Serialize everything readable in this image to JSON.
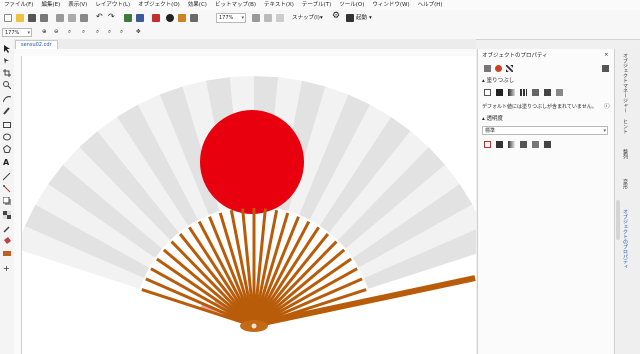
{
  "menu": [
    "ファイル(F)",
    "編集(E)",
    "表示(V)",
    "レイアウト(L)",
    "オブジェクト(O)",
    "効果(C)",
    "ビットマップ(B)",
    "テキスト(X)",
    "テーブル(T)",
    "ツール(O)",
    "ウィンドウ(W)",
    "ヘルプ(H)"
  ],
  "toolbar": {
    "zoom_value": "177%",
    "snap_label": "スナップ(I)",
    "launch_label": "起動"
  },
  "propbar": {
    "zoom_value": "177%"
  },
  "document": {
    "tab_label": "sensu02.cdr"
  },
  "panel": {
    "title": "オブジェクトのプロパティ",
    "fill_section": "塗りつぶし",
    "fill_message": "デフォルト値には塗りつぶしが含まれていません。",
    "transparency_section": "透明度",
    "transparency_mode": "標準"
  },
  "dock_tabs": [
    "オブジェクトマネージャー",
    "ヒント",
    "整列",
    "変形",
    "オブジェクトのプロパティ"
  ],
  "colors": {
    "accent": "#1a55b0",
    "sun_red": "#e8000f",
    "rib_brown": "#b85c0a",
    "fan_light": "#f2f2f2",
    "fan_mid": "#e2e2e2"
  },
  "icons": [
    "pointer-icon",
    "shape-icon",
    "crop-icon",
    "zoom-icon",
    "freehand-icon",
    "rectangle-icon",
    "ellipse-icon",
    "polygon-icon",
    "text-icon",
    "parallel-dimension-icon",
    "connector-icon",
    "drop-shadow-icon",
    "transparency-icon",
    "eyedropper-icon",
    "interactive-fill-icon",
    "smart-fill-icon",
    "new-icon",
    "open-icon",
    "save-icon",
    "print-icon",
    "undo-icon",
    "redo-icon",
    "import-icon",
    "export-icon",
    "settings-icon"
  ]
}
